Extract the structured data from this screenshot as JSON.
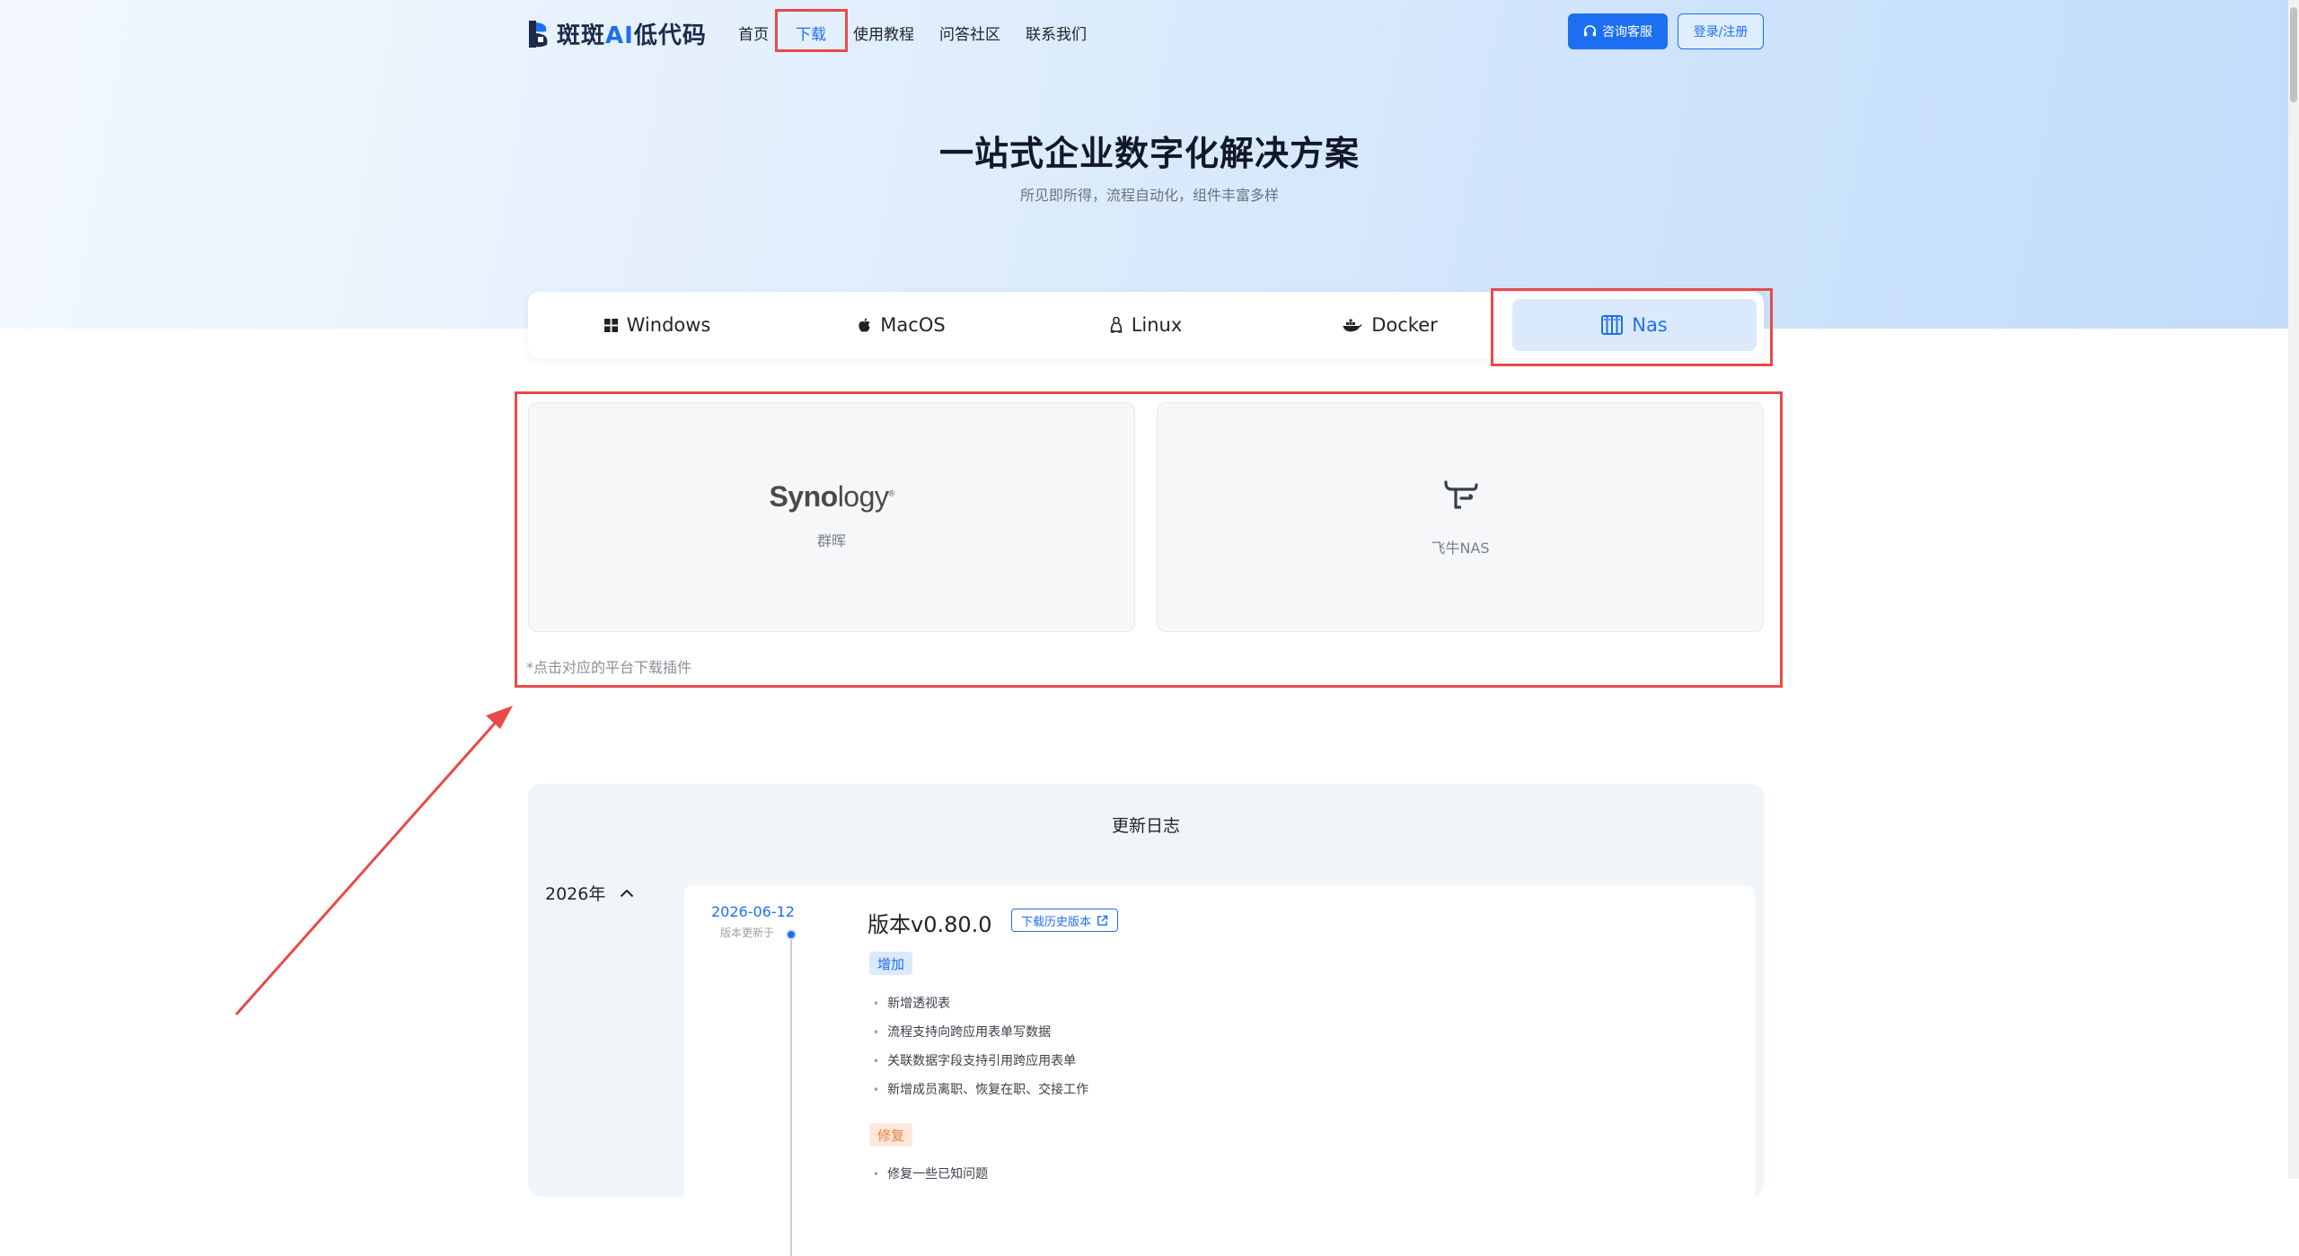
{
  "header": {
    "logo_brand": "斑斑",
    "logo_ai": "AI",
    "logo_suffix": "低代码",
    "nav": [
      {
        "label": "首页"
      },
      {
        "label": "下载",
        "active": true
      },
      {
        "label": "使用教程"
      },
      {
        "label": "问答社区"
      },
      {
        "label": "联系我们"
      }
    ],
    "consult_label": "咨询客服",
    "login_label": "登录/注册"
  },
  "hero": {
    "title": "一站式企业数字化解决方案",
    "subtitle": "所见即所得，流程自动化，组件丰富多样"
  },
  "os_tabs": [
    {
      "label": "Windows",
      "icon": "windows-icon"
    },
    {
      "label": "MacOS",
      "icon": "apple-icon"
    },
    {
      "label": "Linux",
      "icon": "linux-icon"
    },
    {
      "label": "Docker",
      "icon": "docker-icon"
    },
    {
      "label": "Nas",
      "icon": "nas-icon",
      "active": true
    }
  ],
  "platforms": {
    "synology": {
      "logo_bold": "Syno",
      "logo_light": "logy",
      "label": "群晖"
    },
    "fnos": {
      "label": "飞牛NAS"
    },
    "hint": "*点击对应的平台下载插件"
  },
  "changelog": {
    "title": "更新日志",
    "year": "2026年",
    "entry": {
      "date": "2026-06-12",
      "date_sub": "版本更新于",
      "version": "版本v0.80.0",
      "history_label": "下载历史版本",
      "add_tag": "增加",
      "add_items": [
        "新增透视表",
        "流程支持向跨应用表单写数据",
        "关联数据字段支持引用跨应用表单",
        "新增成员离职、恢复在职、交接工作"
      ],
      "fix_tag": "修复",
      "fix_items": [
        "修复一些已知问题"
      ]
    }
  },
  "colors": {
    "accent": "#1d6ff2",
    "annotation": "#e94a4a",
    "fix": "#f07f3c"
  }
}
